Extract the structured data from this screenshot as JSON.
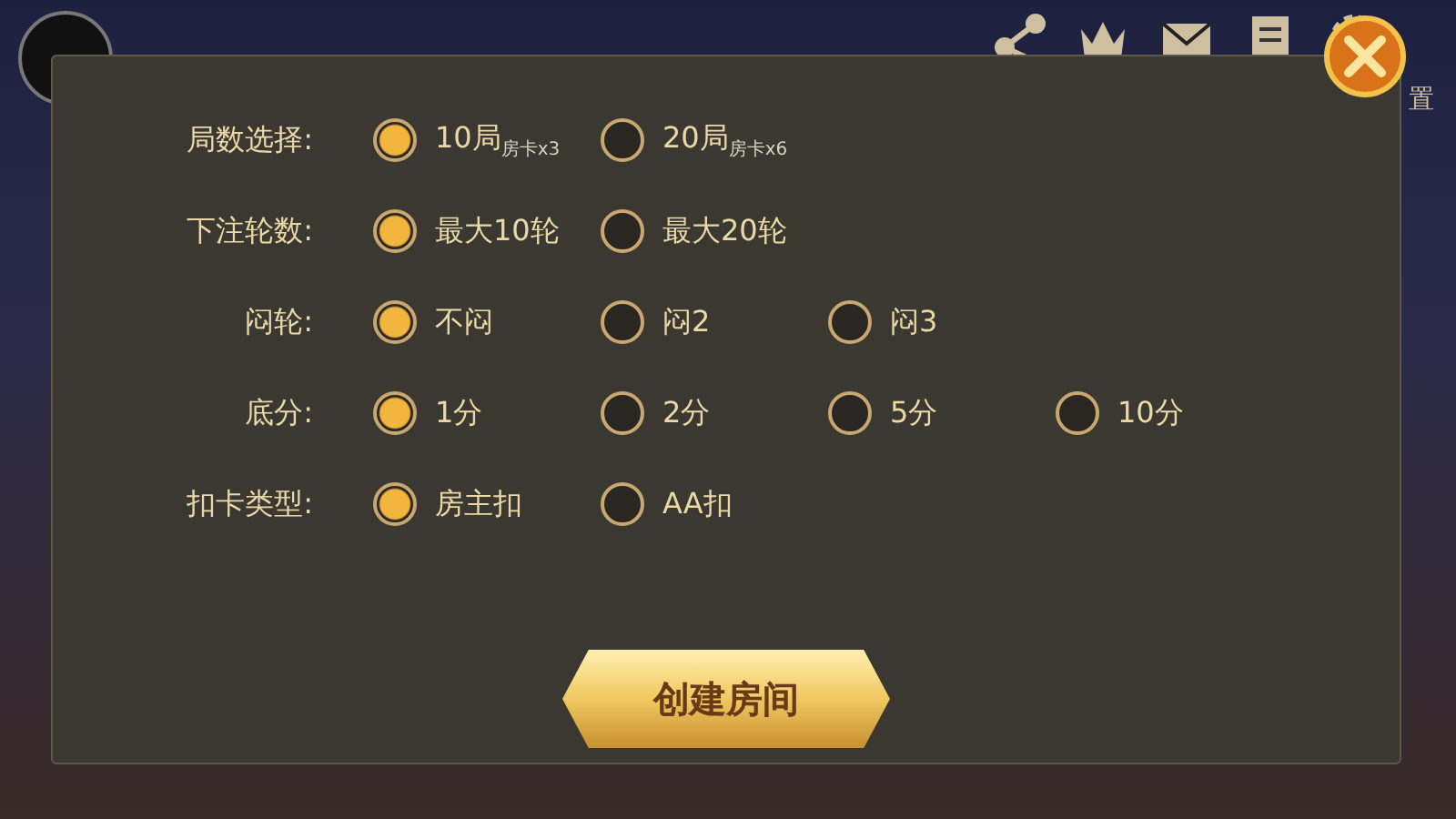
{
  "top_bar": {
    "settings_label": "置"
  },
  "settings": [
    {
      "label": "局数选择:",
      "options": [
        {
          "text": "10局$_{房卡x3}$",
          "selected": true
        },
        {
          "text": "20局$_{房卡x6}$",
          "selected": false
        }
      ]
    },
    {
      "label": "下注轮数:",
      "options": [
        {
          "text": "最大10轮",
          "selected": true
        },
        {
          "text": "最大20轮",
          "selected": false
        }
      ]
    },
    {
      "label": "闷轮:",
      "options": [
        {
          "text": "不闷",
          "selected": true
        },
        {
          "text": "闷2",
          "selected": false
        },
        {
          "text": "闷3",
          "selected": false
        }
      ]
    },
    {
      "label": "底分:",
      "options": [
        {
          "text": "1分",
          "selected": true
        },
        {
          "text": "2分",
          "selected": false
        },
        {
          "text": "5分",
          "selected": false
        },
        {
          "text": "10分",
          "selected": false
        }
      ]
    },
    {
      "label": "扣卡类型:",
      "options": [
        {
          "text": "房主扣",
          "selected": true
        },
        {
          "text": "AA扣",
          "selected": false
        }
      ]
    }
  ],
  "create_button": "创建房间"
}
